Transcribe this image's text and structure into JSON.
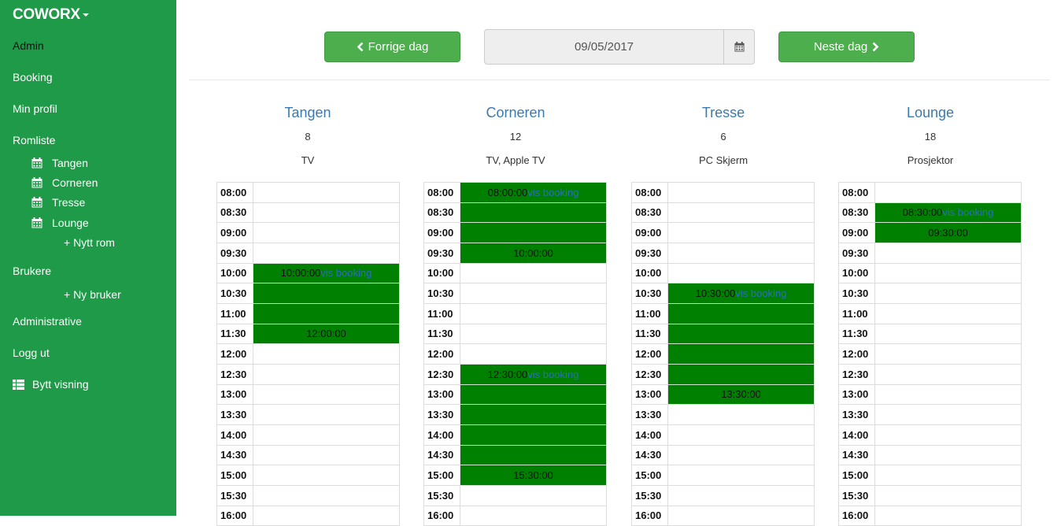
{
  "brand": "COWORX",
  "sidebar": {
    "items": [
      "Admin",
      "Booking",
      "Min profil",
      "Romliste"
    ],
    "rooms": [
      "Tangen",
      "Corneren",
      "Tresse",
      "Lounge"
    ],
    "add_room": "+ Nytt rom",
    "users": "Brukere",
    "add_user": "+ Ny bruker",
    "administrative": "Administrative",
    "logout": "Logg ut",
    "switch_view": "Bytt visning",
    "icons": {
      "room": "calendar-icon",
      "switch_view": "list-icon"
    }
  },
  "toolbar": {
    "prev_label": "Forrige dag",
    "next_label": "Neste dag",
    "date": "09/05/2017",
    "icons": {
      "prev": "chevron-left-icon",
      "next": "chevron-right-icon",
      "date": "calendar-icon"
    }
  },
  "times": [
    "08:00",
    "08:30",
    "09:00",
    "09:30",
    "10:00",
    "10:30",
    "11:00",
    "11:30",
    "12:00",
    "12:30",
    "13:00",
    "13:30",
    "14:00",
    "14:30",
    "15:00",
    "15:30",
    "16:00"
  ],
  "link_label": "vis booking",
  "booking_color": "#008000",
  "rooms": [
    {
      "name": "Tangen",
      "capacity": "8",
      "equipment": "TV",
      "cells": [
        {
          "b": 0
        },
        {
          "b": 0
        },
        {
          "b": 0
        },
        {
          "b": 0
        },
        {
          "b": 1,
          "text": "10:00:00",
          "link": true
        },
        {
          "b": 1
        },
        {
          "b": 1
        },
        {
          "b": 1,
          "text": "12:00:00"
        },
        {
          "b": 0
        },
        {
          "b": 0
        },
        {
          "b": 0
        },
        {
          "b": 0
        },
        {
          "b": 0
        },
        {
          "b": 0
        },
        {
          "b": 0
        },
        {
          "b": 0
        },
        {
          "b": 0
        }
      ]
    },
    {
      "name": "Corneren",
      "capacity": "12",
      "equipment": "TV, Apple TV",
      "cells": [
        {
          "b": 1,
          "text": "08:00:00",
          "link": true
        },
        {
          "b": 1
        },
        {
          "b": 1
        },
        {
          "b": 1,
          "text": "10:00:00"
        },
        {
          "b": 0
        },
        {
          "b": 0
        },
        {
          "b": 0
        },
        {
          "b": 0
        },
        {
          "b": 0
        },
        {
          "b": 1,
          "text": "12:30:00",
          "link": true
        },
        {
          "b": 1
        },
        {
          "b": 1
        },
        {
          "b": 1
        },
        {
          "b": 1
        },
        {
          "b": 1,
          "text": "15:30:00"
        },
        {
          "b": 0
        },
        {
          "b": 0
        }
      ]
    },
    {
      "name": "Tresse",
      "capacity": "6",
      "equipment": "PC Skjerm",
      "cells": [
        {
          "b": 0
        },
        {
          "b": 0
        },
        {
          "b": 0
        },
        {
          "b": 0
        },
        {
          "b": 0
        },
        {
          "b": 1,
          "text": "10:30:00",
          "link": true
        },
        {
          "b": 1
        },
        {
          "b": 1
        },
        {
          "b": 1
        },
        {
          "b": 1
        },
        {
          "b": 1,
          "text": "13:30:00"
        },
        {
          "b": 0
        },
        {
          "b": 0
        },
        {
          "b": 0
        },
        {
          "b": 0
        },
        {
          "b": 0
        },
        {
          "b": 0
        }
      ]
    },
    {
      "name": "Lounge",
      "capacity": "18",
      "equipment": "Prosjektor",
      "cells": [
        {
          "b": 0
        },
        {
          "b": 1,
          "text": "08:30:00",
          "link": true
        },
        {
          "b": 1,
          "text": "09:30:00"
        },
        {
          "b": 0
        },
        {
          "b": 0
        },
        {
          "b": 0
        },
        {
          "b": 0
        },
        {
          "b": 0
        },
        {
          "b": 0
        },
        {
          "b": 0
        },
        {
          "b": 0
        },
        {
          "b": 0
        },
        {
          "b": 0
        },
        {
          "b": 0
        },
        {
          "b": 0
        },
        {
          "b": 0
        },
        {
          "b": 0
        }
      ]
    }
  ]
}
